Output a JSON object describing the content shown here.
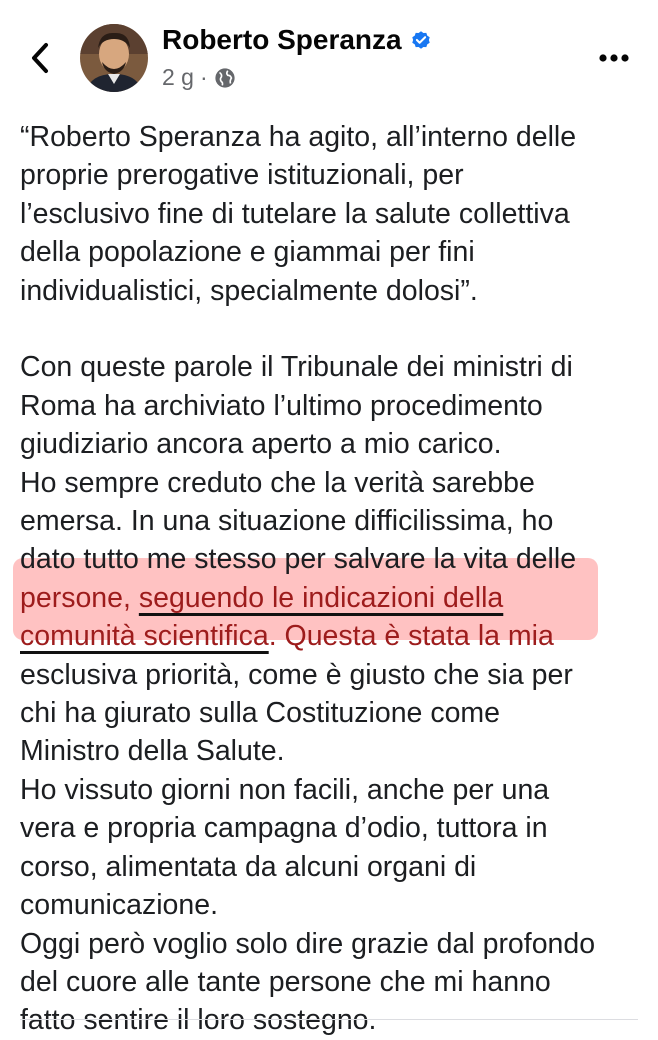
{
  "header": {
    "author_name": "Roberto Speranza",
    "post_time": "2 g",
    "separator": "·",
    "back_icon": "chevron-left-icon",
    "verified_icon": "verified-badge-icon",
    "globe_icon": "globe-icon",
    "more_icon": "more-horizontal-icon"
  },
  "post": {
    "quote_lines": [
      "“Roberto Speranza ha agito, all’interno delle",
      "proprie prerogative istituzionali, per",
      "l’esclusivo fine di tutelare la salute collettiva",
      "della popolazione e giammai per fini",
      "individualistici, specialmente dolosi”."
    ],
    "body_lines_a": [
      "Con queste parole il Tribunale dei ministri di",
      "Roma ha archiviato l’ultimo procedimento",
      "giudiziario ancora aperto a mio carico.",
      "Ho sempre creduto che la verità sarebbe",
      "emersa. In una situazione difficilissima, ho",
      "dato tutto me stesso per salvare la vita delle"
    ],
    "highlight_line1_plain": "persone, ",
    "highlight_line1_underlined": "seguendo le indicazioni della",
    "highlight_line2_underlined": "comunità scientifica",
    "highlight_line2_plain": ". Questa è stata la mia",
    "body_lines_b": [
      "esclusiva priorità, come è giusto che sia per",
      "chi ha giurato sulla Costituzione come",
      "Ministro della Salute.",
      "Ho vissuto giorni non facili, anche per una",
      "vera e propria campagna d’odio, tuttora in",
      "corso, alimentata da alcuni organi di",
      "comunicazione.",
      "Oggi però voglio solo dire grazie dal profondo",
      "del cuore alle tante persone che mi hanno",
      "fatto sentire il loro sostegno."
    ]
  },
  "colors": {
    "highlight_bg": "#ff7878",
    "highlight_text": "#9d1c1c",
    "verified_blue": "#1877f2",
    "meta_gray": "#65676b"
  }
}
